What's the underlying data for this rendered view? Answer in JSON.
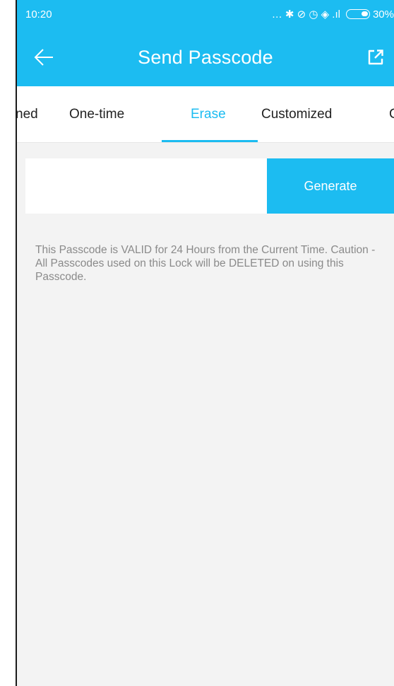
{
  "status_bar": {
    "time": "10:20",
    "icons_text": "… ✱ ⊘ ◷ ◈ .ıl",
    "battery_text": "30%"
  },
  "header": {
    "title": "Send Passcode",
    "back_icon": "arrow-left-icon",
    "share_icon": "share-external-icon"
  },
  "tabs": {
    "items": [
      {
        "label": "ned"
      },
      {
        "label": "One-time"
      },
      {
        "label": "Erase"
      },
      {
        "label": "Customized"
      },
      {
        "label": "C"
      }
    ],
    "active_index": 2,
    "accent_color": "#1cbcf1"
  },
  "generate": {
    "input_value": "",
    "button_label": "Generate"
  },
  "note": {
    "text": "This Passcode is VALID for 24 Hours from the Current Time. Caution - All Passcodes used on this Lock will be DELETED on using this Passcode."
  },
  "colors": {
    "primary": "#1cbcf1",
    "background": "#f3f3f3",
    "note_text": "#8a8a8a"
  }
}
